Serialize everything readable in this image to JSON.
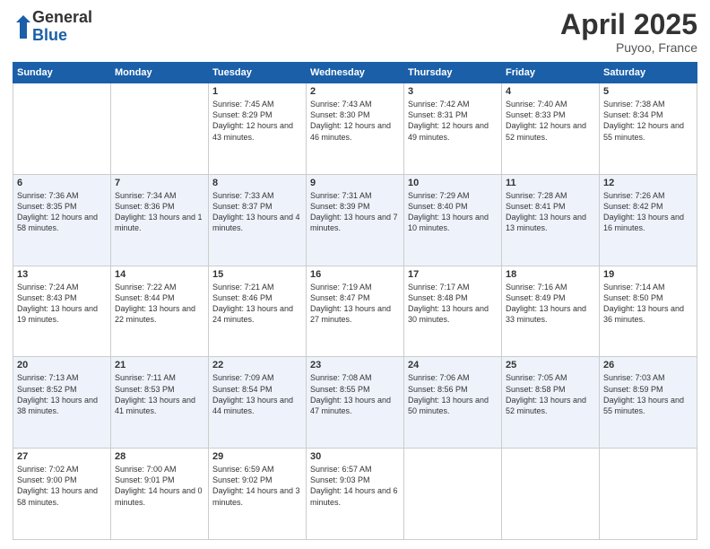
{
  "header": {
    "logo_general": "General",
    "logo_blue": "Blue",
    "month_title": "April 2025",
    "location": "Puyoo, France"
  },
  "days_of_week": [
    "Sunday",
    "Monday",
    "Tuesday",
    "Wednesday",
    "Thursday",
    "Friday",
    "Saturday"
  ],
  "weeks": [
    [
      {
        "day": "",
        "sunrise": "",
        "sunset": "",
        "daylight": ""
      },
      {
        "day": "",
        "sunrise": "",
        "sunset": "",
        "daylight": ""
      },
      {
        "day": "1",
        "sunrise": "Sunrise: 7:45 AM",
        "sunset": "Sunset: 8:29 PM",
        "daylight": "Daylight: 12 hours and 43 minutes."
      },
      {
        "day": "2",
        "sunrise": "Sunrise: 7:43 AM",
        "sunset": "Sunset: 8:30 PM",
        "daylight": "Daylight: 12 hours and 46 minutes."
      },
      {
        "day": "3",
        "sunrise": "Sunrise: 7:42 AM",
        "sunset": "Sunset: 8:31 PM",
        "daylight": "Daylight: 12 hours and 49 minutes."
      },
      {
        "day": "4",
        "sunrise": "Sunrise: 7:40 AM",
        "sunset": "Sunset: 8:33 PM",
        "daylight": "Daylight: 12 hours and 52 minutes."
      },
      {
        "day": "5",
        "sunrise": "Sunrise: 7:38 AM",
        "sunset": "Sunset: 8:34 PM",
        "daylight": "Daylight: 12 hours and 55 minutes."
      }
    ],
    [
      {
        "day": "6",
        "sunrise": "Sunrise: 7:36 AM",
        "sunset": "Sunset: 8:35 PM",
        "daylight": "Daylight: 12 hours and 58 minutes."
      },
      {
        "day": "7",
        "sunrise": "Sunrise: 7:34 AM",
        "sunset": "Sunset: 8:36 PM",
        "daylight": "Daylight: 13 hours and 1 minute."
      },
      {
        "day": "8",
        "sunrise": "Sunrise: 7:33 AM",
        "sunset": "Sunset: 8:37 PM",
        "daylight": "Daylight: 13 hours and 4 minutes."
      },
      {
        "day": "9",
        "sunrise": "Sunrise: 7:31 AM",
        "sunset": "Sunset: 8:39 PM",
        "daylight": "Daylight: 13 hours and 7 minutes."
      },
      {
        "day": "10",
        "sunrise": "Sunrise: 7:29 AM",
        "sunset": "Sunset: 8:40 PM",
        "daylight": "Daylight: 13 hours and 10 minutes."
      },
      {
        "day": "11",
        "sunrise": "Sunrise: 7:28 AM",
        "sunset": "Sunset: 8:41 PM",
        "daylight": "Daylight: 13 hours and 13 minutes."
      },
      {
        "day": "12",
        "sunrise": "Sunrise: 7:26 AM",
        "sunset": "Sunset: 8:42 PM",
        "daylight": "Daylight: 13 hours and 16 minutes."
      }
    ],
    [
      {
        "day": "13",
        "sunrise": "Sunrise: 7:24 AM",
        "sunset": "Sunset: 8:43 PM",
        "daylight": "Daylight: 13 hours and 19 minutes."
      },
      {
        "day": "14",
        "sunrise": "Sunrise: 7:22 AM",
        "sunset": "Sunset: 8:44 PM",
        "daylight": "Daylight: 13 hours and 22 minutes."
      },
      {
        "day": "15",
        "sunrise": "Sunrise: 7:21 AM",
        "sunset": "Sunset: 8:46 PM",
        "daylight": "Daylight: 13 hours and 24 minutes."
      },
      {
        "day": "16",
        "sunrise": "Sunrise: 7:19 AM",
        "sunset": "Sunset: 8:47 PM",
        "daylight": "Daylight: 13 hours and 27 minutes."
      },
      {
        "day": "17",
        "sunrise": "Sunrise: 7:17 AM",
        "sunset": "Sunset: 8:48 PM",
        "daylight": "Daylight: 13 hours and 30 minutes."
      },
      {
        "day": "18",
        "sunrise": "Sunrise: 7:16 AM",
        "sunset": "Sunset: 8:49 PM",
        "daylight": "Daylight: 13 hours and 33 minutes."
      },
      {
        "day": "19",
        "sunrise": "Sunrise: 7:14 AM",
        "sunset": "Sunset: 8:50 PM",
        "daylight": "Daylight: 13 hours and 36 minutes."
      }
    ],
    [
      {
        "day": "20",
        "sunrise": "Sunrise: 7:13 AM",
        "sunset": "Sunset: 8:52 PM",
        "daylight": "Daylight: 13 hours and 38 minutes."
      },
      {
        "day": "21",
        "sunrise": "Sunrise: 7:11 AM",
        "sunset": "Sunset: 8:53 PM",
        "daylight": "Daylight: 13 hours and 41 minutes."
      },
      {
        "day": "22",
        "sunrise": "Sunrise: 7:09 AM",
        "sunset": "Sunset: 8:54 PM",
        "daylight": "Daylight: 13 hours and 44 minutes."
      },
      {
        "day": "23",
        "sunrise": "Sunrise: 7:08 AM",
        "sunset": "Sunset: 8:55 PM",
        "daylight": "Daylight: 13 hours and 47 minutes."
      },
      {
        "day": "24",
        "sunrise": "Sunrise: 7:06 AM",
        "sunset": "Sunset: 8:56 PM",
        "daylight": "Daylight: 13 hours and 50 minutes."
      },
      {
        "day": "25",
        "sunrise": "Sunrise: 7:05 AM",
        "sunset": "Sunset: 8:58 PM",
        "daylight": "Daylight: 13 hours and 52 minutes."
      },
      {
        "day": "26",
        "sunrise": "Sunrise: 7:03 AM",
        "sunset": "Sunset: 8:59 PM",
        "daylight": "Daylight: 13 hours and 55 minutes."
      }
    ],
    [
      {
        "day": "27",
        "sunrise": "Sunrise: 7:02 AM",
        "sunset": "Sunset: 9:00 PM",
        "daylight": "Daylight: 13 hours and 58 minutes."
      },
      {
        "day": "28",
        "sunrise": "Sunrise: 7:00 AM",
        "sunset": "Sunset: 9:01 PM",
        "daylight": "Daylight: 14 hours and 0 minutes."
      },
      {
        "day": "29",
        "sunrise": "Sunrise: 6:59 AM",
        "sunset": "Sunset: 9:02 PM",
        "daylight": "Daylight: 14 hours and 3 minutes."
      },
      {
        "day": "30",
        "sunrise": "Sunrise: 6:57 AM",
        "sunset": "Sunset: 9:03 PM",
        "daylight": "Daylight: 14 hours and 6 minutes."
      },
      {
        "day": "",
        "sunrise": "",
        "sunset": "",
        "daylight": ""
      },
      {
        "day": "",
        "sunrise": "",
        "sunset": "",
        "daylight": ""
      },
      {
        "day": "",
        "sunrise": "",
        "sunset": "",
        "daylight": ""
      }
    ]
  ]
}
